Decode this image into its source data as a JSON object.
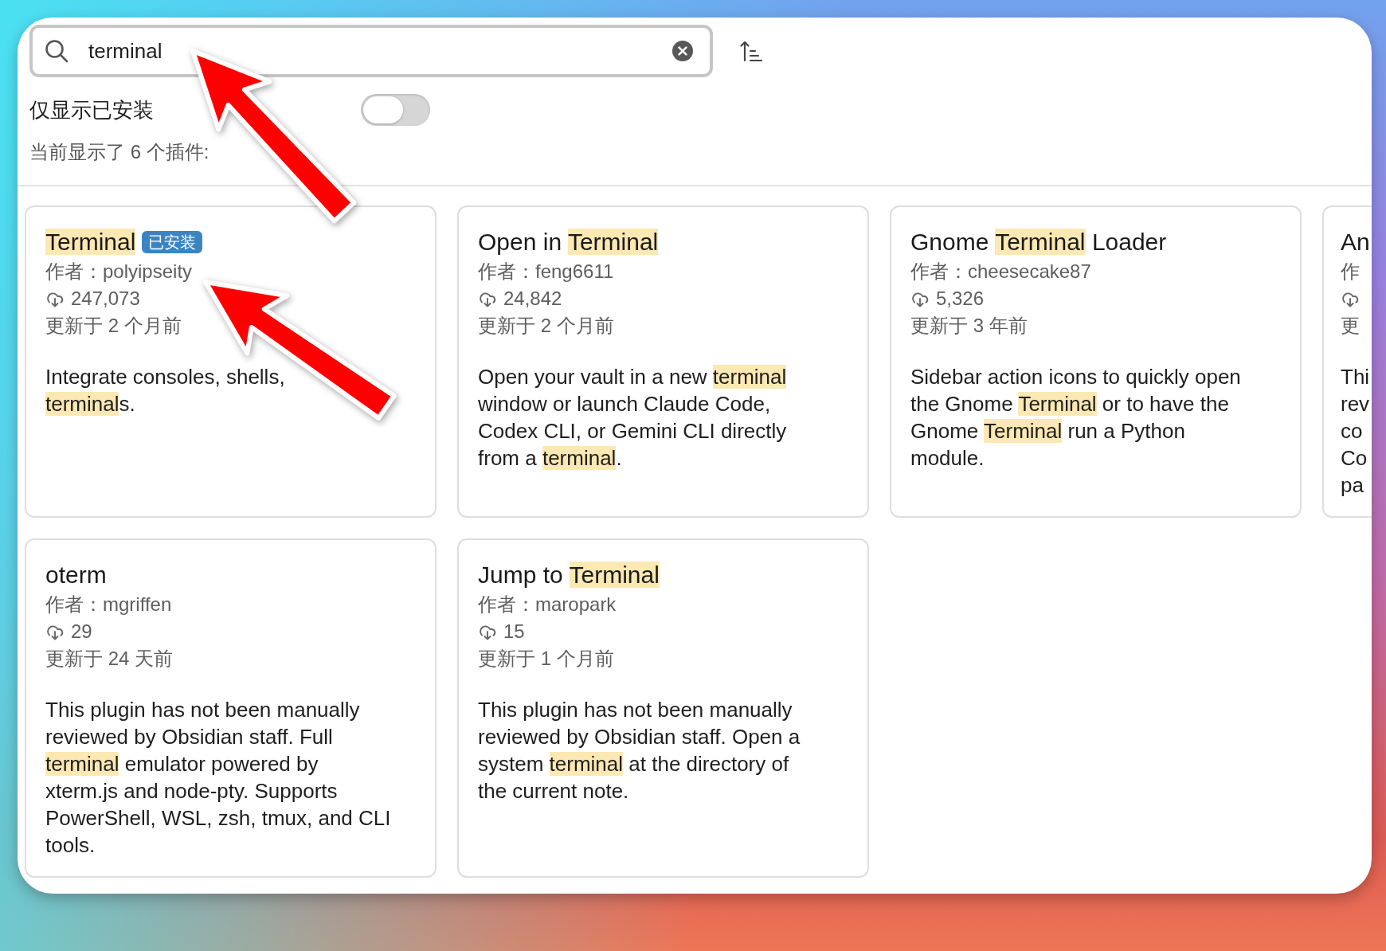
{
  "search": {
    "value": "terminal"
  },
  "installed_only": {
    "label": "仅显示已安装",
    "on": false
  },
  "result_count": "当前显示了 6 个插件:",
  "plugins": [
    {
      "title": [
        {
          "text": "Terminal",
          "highlight": true
        }
      ],
      "badge": "已安装",
      "author": "作者：polyipseity",
      "downloads": "247,073",
      "updated": "更新于 2 个月前",
      "description": [
        [
          {
            "text": "Integrate consoles, shells,",
            "highlight": false
          }
        ],
        [
          {
            "text": "terminal",
            "highlight": true
          },
          {
            "text": "s.",
            "highlight": false
          }
        ]
      ]
    },
    {
      "title": [
        {
          "text": "Open in ",
          "highlight": false
        },
        {
          "text": "Terminal",
          "highlight": true
        }
      ],
      "author": "作者：feng6611",
      "downloads": "24,842",
      "updated": "更新于 2 个月前",
      "description": [
        [
          {
            "text": "Open your vault in a new ",
            "highlight": false
          },
          {
            "text": "terminal",
            "highlight": true
          }
        ],
        [
          {
            "text": "window or launch Claude Code,",
            "highlight": false
          }
        ],
        [
          {
            "text": "Codex CLI, or Gemini CLI directly",
            "highlight": false
          }
        ],
        [
          {
            "text": "from a ",
            "highlight": false
          },
          {
            "text": "terminal",
            "highlight": true
          },
          {
            "text": ".",
            "highlight": false
          }
        ]
      ]
    },
    {
      "title": [
        {
          "text": "Gnome ",
          "highlight": false
        },
        {
          "text": "Terminal",
          "highlight": true
        },
        {
          "text": " Loader",
          "highlight": false
        }
      ],
      "author": "作者：cheesecake87",
      "downloads": "5,326",
      "updated": "更新于 3 年前",
      "description": [
        [
          {
            "text": "Sidebar action icons to quickly open",
            "highlight": false
          }
        ],
        [
          {
            "text": "the Gnome ",
            "highlight": false
          },
          {
            "text": "Terminal",
            "highlight": true
          },
          {
            "text": " or to have the",
            "highlight": false
          }
        ],
        [
          {
            "text": "Gnome ",
            "highlight": false
          },
          {
            "text": "Terminal",
            "highlight": true
          },
          {
            "text": " run a Python",
            "highlight": false
          }
        ],
        [
          {
            "text": "module.",
            "highlight": false
          }
        ]
      ]
    },
    {
      "title": [
        {
          "text": "An",
          "highlight": false
        }
      ],
      "author": "作",
      "updated": "更",
      "description": [
        [
          {
            "text": "Thi",
            "highlight": false
          }
        ],
        [
          {
            "text": "rev",
            "highlight": false
          }
        ],
        [
          {
            "text": "co",
            "highlight": false
          }
        ],
        [
          {
            "text": "Co",
            "highlight": false
          }
        ],
        [
          {
            "text": "pa",
            "highlight": false
          }
        ]
      ]
    },
    {
      "title": [
        {
          "text": "oterm",
          "highlight": false
        }
      ],
      "author": "作者：mgriffen",
      "downloads": "29",
      "updated": "更新于 24 天前",
      "description": [
        [
          {
            "text": "This plugin has not been manually",
            "highlight": false
          }
        ],
        [
          {
            "text": "reviewed by Obsidian staff. Full",
            "highlight": false
          }
        ],
        [
          {
            "text": "terminal",
            "highlight": true
          },
          {
            "text": " emulator powered by",
            "highlight": false
          }
        ],
        [
          {
            "text": "xterm.js and node-pty. Supports",
            "highlight": false
          }
        ],
        [
          {
            "text": "PowerShell, WSL, zsh, tmux, and CLI",
            "highlight": false
          }
        ],
        [
          {
            "text": "tools.",
            "highlight": false
          }
        ]
      ]
    },
    {
      "title": [
        {
          "text": "Jump to ",
          "highlight": false
        },
        {
          "text": "Terminal",
          "highlight": true
        }
      ],
      "author": "作者：maropark",
      "downloads": "15",
      "updated": "更新于 1 个月前",
      "description": [
        [
          {
            "text": "This plugin has not been manually",
            "highlight": false
          }
        ],
        [
          {
            "text": "reviewed by Obsidian staff. Open a",
            "highlight": false
          }
        ],
        [
          {
            "text": "system ",
            "highlight": false
          },
          {
            "text": "terminal",
            "highlight": true
          },
          {
            "text": " at the directory of",
            "highlight": false
          }
        ],
        [
          {
            "text": "the current note.",
            "highlight": false
          }
        ]
      ]
    }
  ],
  "annotations": [
    {
      "kind": "arrow"
    },
    {
      "kind": "arrow"
    }
  ]
}
